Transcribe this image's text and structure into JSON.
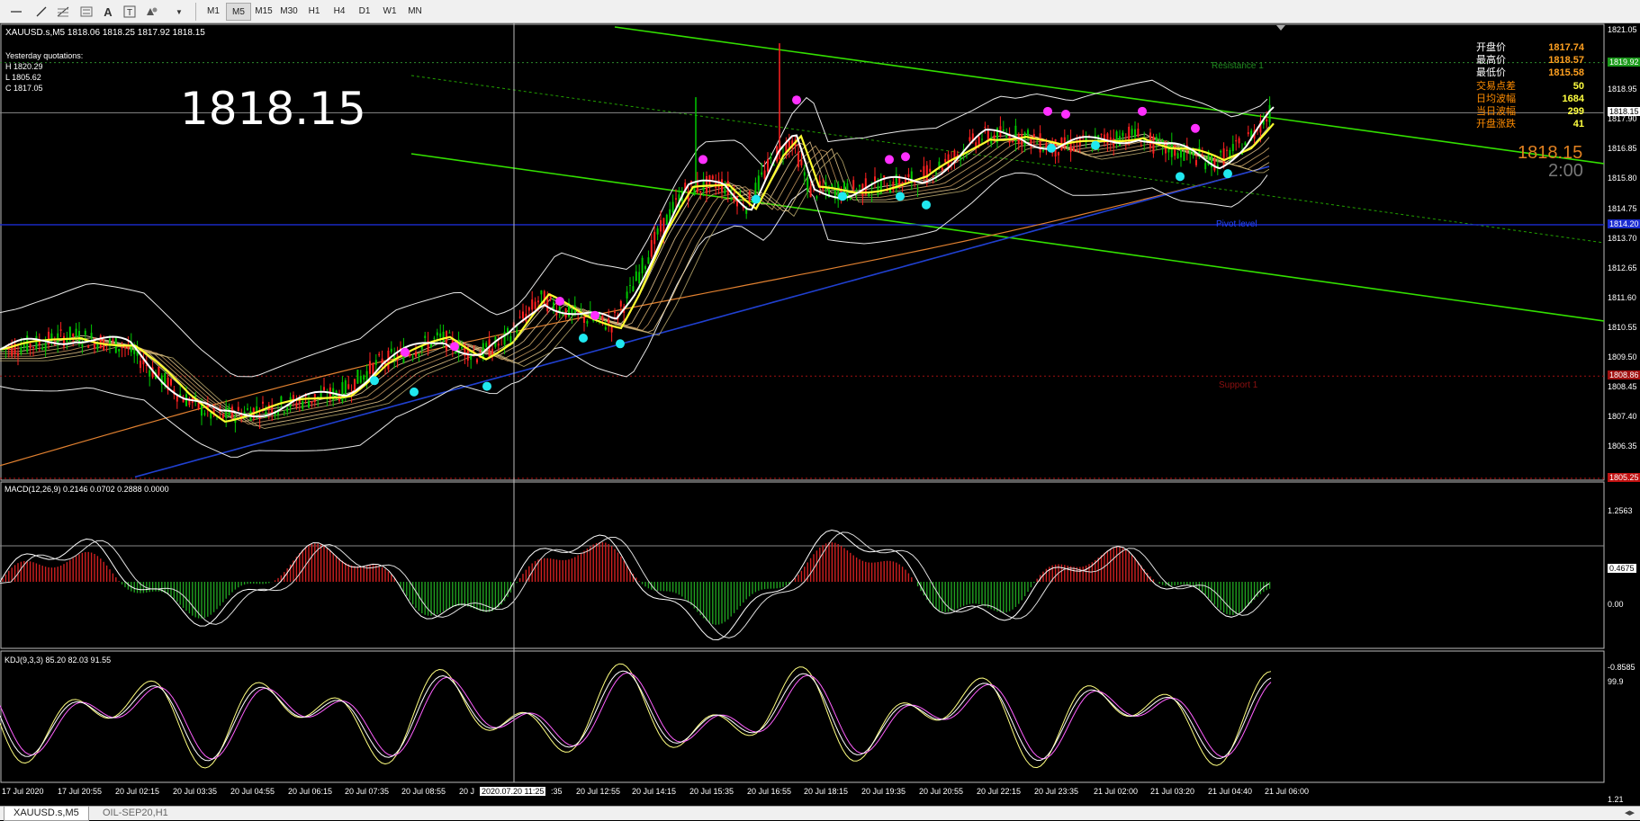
{
  "toolbar": {
    "tools": [
      "cursor-line-icon",
      "trendline-icon",
      "fibonacci-icon",
      "channel-icon",
      "text-icon",
      "text-label-icon",
      "shapes-icon",
      "dropdown-arrow-icon"
    ],
    "timeframes": [
      "M1",
      "M5",
      "M15",
      "M30",
      "H1",
      "H4",
      "D1",
      "W1",
      "MN"
    ],
    "active_timeframe": "M5"
  },
  "chart": {
    "symbol_header": "XAUUSD.s,M5  1818.06 1818.25 1817.92 1818.15",
    "yesterday": {
      "title": "Yesterday quotations:",
      "high": "H 1820.29",
      "low": "L 1805.62",
      "close": "C 1817.05"
    },
    "big_price": "1818.15",
    "right_price": "1818.15",
    "countdown": "2:00",
    "levels": {
      "resistance": "Resistance 1",
      "pivot": "Pivot level",
      "support": "Support 1"
    },
    "stats": [
      {
        "label": "开盘价",
        "value": "1817.74"
      },
      {
        "label": "最高价",
        "value": "1818.57"
      },
      {
        "label": "最低价",
        "value": "1815.58"
      },
      {
        "label": "交易点差",
        "value": "50"
      },
      {
        "label": "日均波幅",
        "value": "1684"
      },
      {
        "label": "当日波幅",
        "value": "299"
      },
      {
        "label": "开盘涨跌",
        "value": "41"
      }
    ],
    "price_axis": [
      "1821.05",
      "1819.92",
      "1818.95",
      "1818.15",
      "1817.90",
      "1816.85",
      "1815.80",
      "1814.75",
      "1814.20",
      "1813.70",
      "1812.65",
      "1811.60",
      "1810.55",
      "1809.50",
      "1808.86",
      "1808.45",
      "1807.40",
      "1806.35",
      "1805.25"
    ],
    "time_axis": [
      "17 Jul 2020",
      "17 Jul 20:55",
      "20 Jul 02:15",
      "20 Jul 03:35",
      "20 Jul 04:55",
      "20 Jul 06:15",
      "20 Jul 07:35",
      "20 Jul 08:55",
      "2020.07.20 11:25",
      "20 Jul 12:55",
      "20 Jul 14:15",
      "20 Jul 15:35",
      "20 Jul 16:55",
      "20 Jul 18:15",
      "20 Jul 19:35",
      "20 Jul 20:55",
      "20 Jul 22:15",
      "20 Jul 23:35",
      "21 Jul 02:00",
      "21 Jul 03:20",
      "21 Jul 04:40",
      "21 Jul 06:00"
    ],
    "time_axis_fragments": [
      "20 J",
      ":35"
    ]
  },
  "macd": {
    "label": "MACD(12,26,9) 0.2146 0.0702 0.2888 0.0000",
    "axis": [
      "1.2563",
      "0.4675",
      "0.00",
      "-0.8585"
    ]
  },
  "kdj": {
    "label": "KDJ(9,3,3) 85.20 82.03 91.55",
    "axis": [
      "99.9",
      "1.21"
    ]
  },
  "tabs": [
    {
      "label": "XAUUSD.s,M5",
      "active": true
    },
    {
      "label": "OIL-SEP20,H1",
      "active": false
    }
  ],
  "colors": {
    "background": "#000000",
    "bull_candle": "#00c800",
    "bear_candle": "#ff2020",
    "channel": "#33e000",
    "pivot": "#1a2bd0",
    "support": "#a01010",
    "ema_fast": "#ffffff",
    "ema_mid": "#ffff30",
    "ma_long": "#e08030",
    "ma_200": "#2040d0",
    "signal_up": "#ff30ff",
    "signal_down": "#20e8f0",
    "stats_value": "#ffa020",
    "big_price": "#ffffff",
    "right_price": "#e08020"
  }
}
